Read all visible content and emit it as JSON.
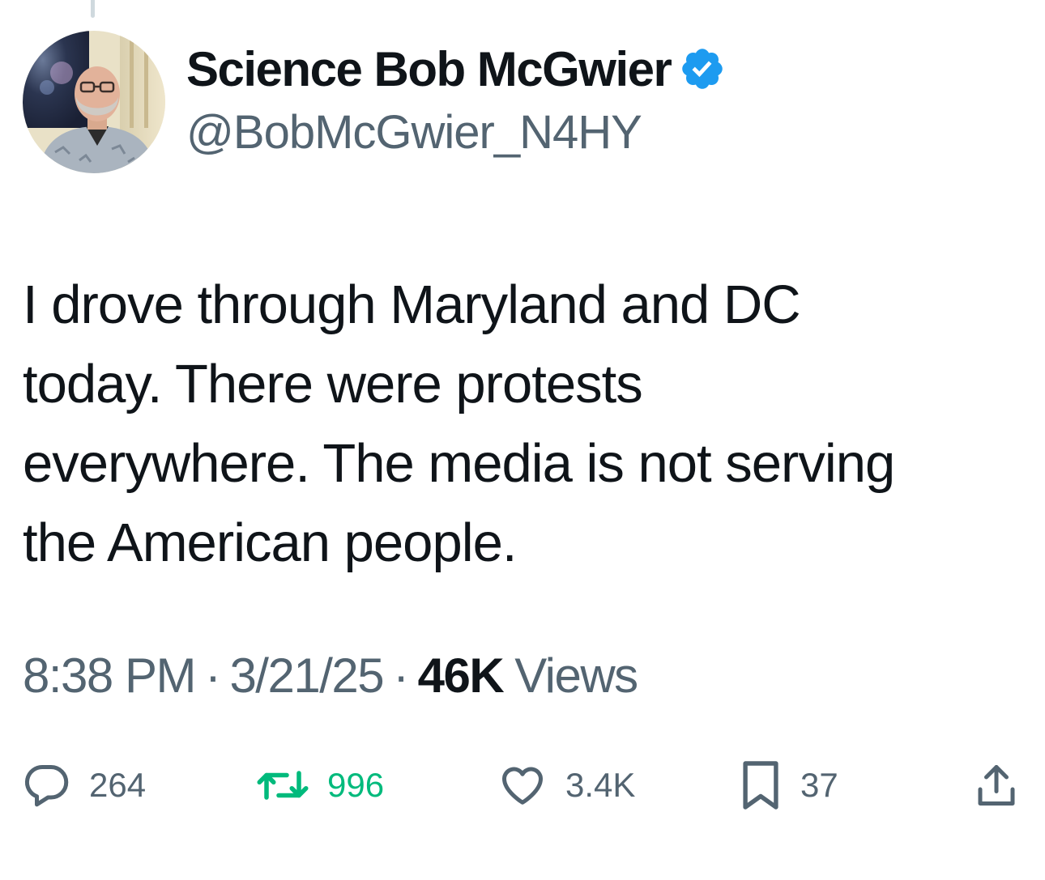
{
  "author": {
    "display_name": "Science Bob McGwier",
    "handle": "@BobMcGwier_N4HY",
    "verified": true,
    "verified_badge_color": "#1d9bf0",
    "avatar_icon": "profile-photo"
  },
  "tweet": {
    "text_lines": [
      "I drove through Maryland and DC",
      "today. There were protests",
      "everywhere. The media is not serving",
      "the American people."
    ]
  },
  "meta": {
    "time": "8:38 PM",
    "separator": "·",
    "date": "3/21/25",
    "views_count": "46K",
    "views_label": "Views"
  },
  "actions": {
    "reply": {
      "icon": "reply-icon",
      "count": "264"
    },
    "retweet": {
      "icon": "retweet-icon",
      "count": "996",
      "color": "#00ba7c"
    },
    "like": {
      "icon": "heart-icon",
      "count": "3.4K"
    },
    "bookmark": {
      "icon": "bookmark-icon",
      "count": "37"
    },
    "share": {
      "icon": "share-icon"
    }
  },
  "colors": {
    "text_primary": "#0f1419",
    "text_secondary": "#536471",
    "accent": "#1d9bf0"
  }
}
